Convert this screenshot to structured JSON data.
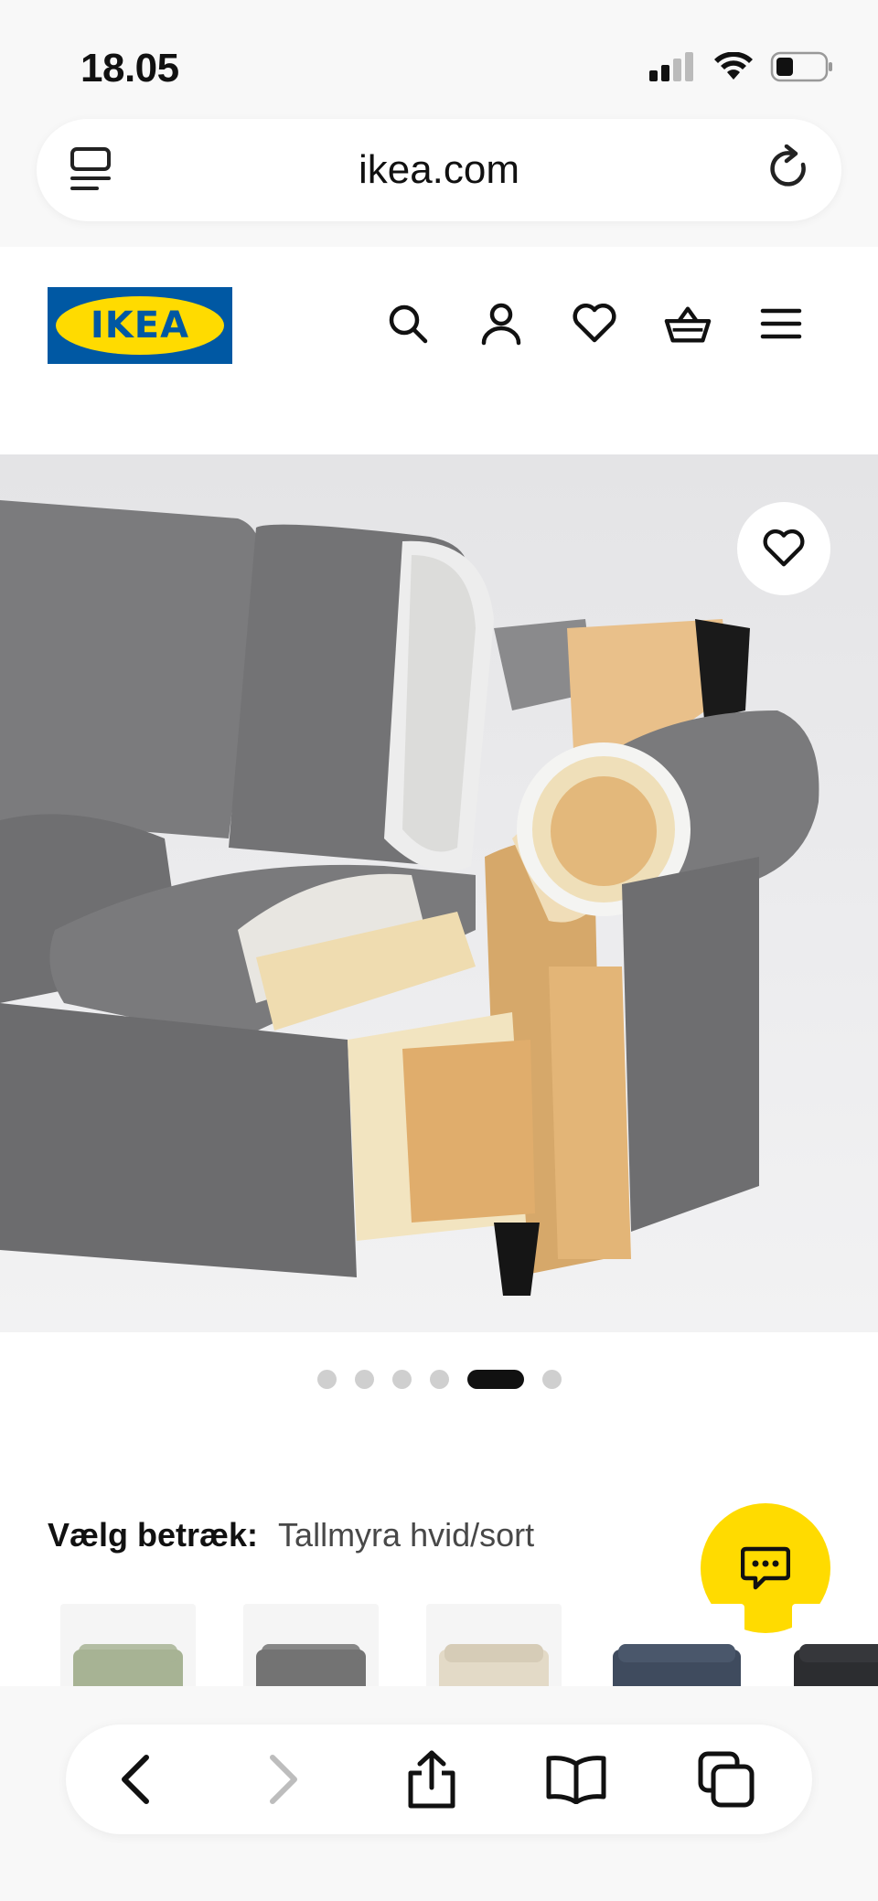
{
  "status_bar": {
    "time": "18.05"
  },
  "browser": {
    "url": "ikea.com"
  },
  "brand": {
    "logo_text": "IKEA",
    "colors": {
      "blue": "#0058a3",
      "yellow": "#ffdb00"
    }
  },
  "header": {
    "icons": [
      "search-icon",
      "account-icon",
      "favourites-icon",
      "cart-icon",
      "menu-icon"
    ]
  },
  "gallery": {
    "total_images": 6,
    "active_index": 4
  },
  "cover": {
    "label": "Vælg betræk:",
    "value": "Tallmyra hvid/sort"
  },
  "swatches": [
    {
      "color": "#a7b394"
    },
    {
      "color": "#737373"
    },
    {
      "color": "#e3dac7"
    },
    {
      "color": "#3f4b5e"
    },
    {
      "color": "#2c2d30"
    }
  ],
  "bottom_nav": [
    "back-icon",
    "forward-icon",
    "share-icon",
    "bookmarks-icon",
    "tabs-icon"
  ]
}
